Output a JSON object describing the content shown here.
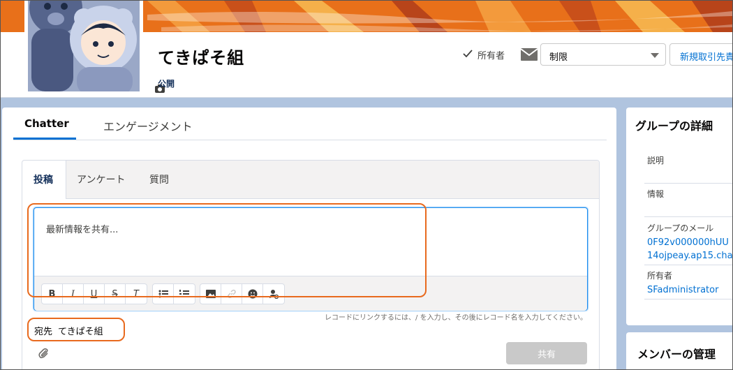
{
  "header": {
    "group_name": "てきぱそ組",
    "visibility": "公開",
    "owner_label": "所有者",
    "restrict_select_value": "制限",
    "new_deal_button": "新規取引先責"
  },
  "main_tabs": [
    {
      "label": "Chatter",
      "active": true
    },
    {
      "label": "エンゲージメント",
      "active": false
    }
  ],
  "publisher": {
    "tabs": [
      {
        "label": "投稿",
        "active": true
      },
      {
        "label": "アンケート",
        "active": false
      },
      {
        "label": "質問",
        "active": false
      }
    ],
    "placeholder": "最新情報を共有...",
    "toolbar": [
      "bold-icon",
      "italic-icon",
      "underline-icon",
      "strikethrough-icon",
      "clear-format-icon",
      "bulleted-list-icon",
      "numbered-list-icon",
      "image-icon",
      "link-icon",
      "emoji-icon",
      "mention-icon"
    ],
    "toolbar_glyphs": {
      "bold": "B",
      "italic": "I",
      "underline": "U",
      "strike": "S",
      "clear": "T"
    },
    "hint": "レコードにリンクするには、/ を入力し、その後にレコード名を入力してください。",
    "recipient_label": "宛先",
    "recipient_value": "てきぱそ組",
    "share_button": "共有"
  },
  "side": {
    "title": "グループの詳細",
    "description_label": "説明",
    "info_label": "情報",
    "email_label": "グループのメール",
    "email_line1": "0F92v000000hUU",
    "email_line2": "14ojpeay.ap15.cha",
    "owner_label": "所有者",
    "owner_value": "SFadministrator",
    "members_title": "メンバーの管理"
  },
  "colors": {
    "accent": "#0070d2",
    "annotation": "#e86a1e",
    "background": "#b0c4df"
  }
}
